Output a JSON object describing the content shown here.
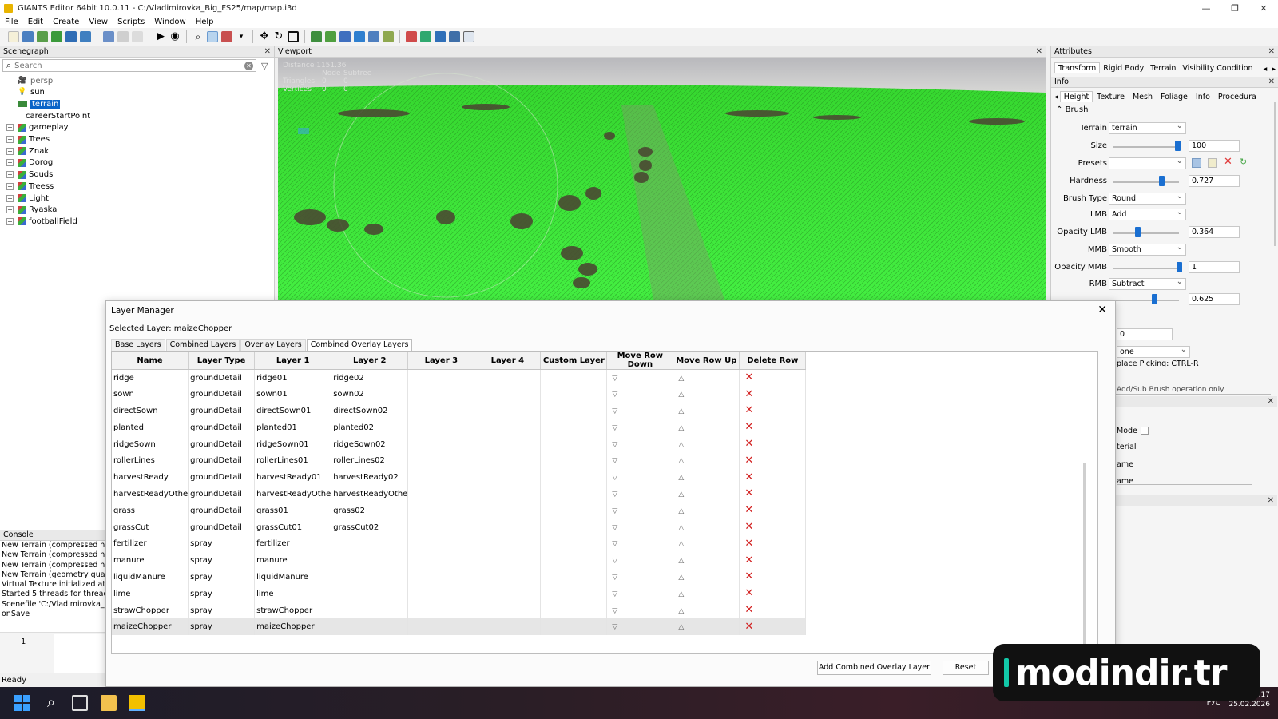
{
  "window": {
    "title": "GIANTS Editor 64bit 10.0.11 - C:/Vladimirovka_Big_FS25/map/map.i3d",
    "minimize": "—",
    "maximize": "❐",
    "close": "✕"
  },
  "menu": [
    "File",
    "Edit",
    "Create",
    "View",
    "Scripts",
    "Window",
    "Help"
  ],
  "scenegraph": {
    "header": "Scenegraph",
    "search_placeholder": "Search",
    "items": [
      {
        "label": "persp",
        "expandable": false
      },
      {
        "label": "sun",
        "expandable": false
      },
      {
        "label": "terrain",
        "expandable": false,
        "selected": true
      },
      {
        "label": "careerStartPoint",
        "expandable": false
      },
      {
        "label": "gameplay",
        "expandable": true
      },
      {
        "label": "Trees",
        "expandable": true
      },
      {
        "label": "Znaki",
        "expandable": true
      },
      {
        "label": "Dorogi",
        "expandable": true
      },
      {
        "label": "Souds",
        "expandable": true
      },
      {
        "label": "Treess",
        "expandable": true
      },
      {
        "label": "Light",
        "expandable": true
      },
      {
        "label": "Ryaska",
        "expandable": true
      },
      {
        "label": "footballField",
        "expandable": true
      }
    ]
  },
  "viewport": {
    "header": "Viewport",
    "stats": {
      "distance": "Distance 1151.36",
      "col_node": "Node",
      "col_subtree": "Subtree",
      "triangles_label": "Triangles",
      "triangles_node": "0",
      "triangles_subtree": "0",
      "vertices_label": "Vertices",
      "vertices_node": "0",
      "vertices_subtree": "0"
    }
  },
  "attributes": {
    "header": "Attributes",
    "tabs": [
      "Transform",
      "Rigid Body",
      "Terrain",
      "Visibility Condition"
    ],
    "info_header": "Info",
    "subtabs": [
      "Height",
      "Texture",
      "Mesh",
      "Foliage",
      "Info",
      "Procedura"
    ],
    "brush_section": "Brush",
    "terrain_label": "Terrain",
    "terrain_value": "terrain",
    "size_label": "Size",
    "size_value": "100",
    "size_level": 0.98,
    "presets_label": "Presets",
    "presets_value": "",
    "hardness_label": "Hardness",
    "hardness_value": "0.727",
    "hardness_level": 0.727,
    "brush_type_label": "Brush Type",
    "brush_type_value": "Round",
    "lmb_label": "LMB",
    "lmb_value": "Add",
    "opacity_lmb_label": "Opacity LMB",
    "opacity_lmb_value": "0.364",
    "opacity_lmb_level": 0.364,
    "mmb_label": "MMB",
    "mmb_value": "Smooth",
    "opacity_mmb_label": "Opacity MMB",
    "opacity_mmb_value": "1",
    "opacity_mmb_level": 1.0,
    "rmb_label": "RMB",
    "rmb_value": "Subtract",
    "opacity_rmb_value": "0.625",
    "opacity_rmb_level": 0.625,
    "partial_zero": "0",
    "partial_none": "one",
    "partial_picking": "place Picking: CTRL-R",
    "partial_addsub": "Add/Sub Brush operation only",
    "partial_mode": "Mode",
    "partial_terial": "terial",
    "partial_name": "ame",
    "partial_name2": "ame"
  },
  "console": {
    "header": "Console",
    "lines": [
      "New Terrain (compressed height",
      "New Terrain (compressed height",
      "New Terrain (compressed height",
      "New Terrain (geometry quadtree",
      "Virtual Texture initialized at 4096",
      "Started 5 threads for threadpool",
      "Scenefile 'C:/Vladimirovka_Big_FS25",
      "onSave"
    ],
    "line_number": "1"
  },
  "status": "Ready",
  "layer_manager": {
    "title": "Layer Manager",
    "close": "✕",
    "selected_layer": "Selected Layer: maizeChopper",
    "tabs": [
      "Base Layers",
      "Combined Layers",
      "Overlay Layers",
      "Combined Overlay Layers"
    ],
    "active_tab": 3,
    "columns": [
      "Name",
      "Layer Type",
      "Layer 1",
      "Layer 2",
      "Layer 3",
      "Layer 4",
      "Custom Layer",
      "Move Row Down",
      "Move Row Up",
      "Delete Row"
    ],
    "rows": [
      [
        "ridge",
        "groundDetail",
        "ridge01",
        "ridge02"
      ],
      [
        "sown",
        "groundDetail",
        "sown01",
        "sown02"
      ],
      [
        "directSown",
        "groundDetail",
        "directSown01",
        "directSown02"
      ],
      [
        "planted",
        "groundDetail",
        "planted01",
        "planted02"
      ],
      [
        "ridgeSown",
        "groundDetail",
        "ridgeSown01",
        "ridgeSown02"
      ],
      [
        "rollerLines",
        "groundDetail",
        "rollerLines01",
        "rollerLines02"
      ],
      [
        "harvestReady",
        "groundDetail",
        "harvestReady01",
        "harvestReady02"
      ],
      [
        "harvestReadyOthe",
        "groundDetail",
        "harvestReadyOthe",
        "harvestReadyOthe"
      ],
      [
        "grass",
        "groundDetail",
        "grass01",
        "grass02"
      ],
      [
        "grassCut",
        "groundDetail",
        "grassCut01",
        "grassCut02"
      ],
      [
        "fertilizer",
        "spray",
        "fertilizer",
        ""
      ],
      [
        "manure",
        "spray",
        "manure",
        ""
      ],
      [
        "liquidManure",
        "spray",
        "liquidManure",
        ""
      ],
      [
        "lime",
        "spray",
        "lime",
        ""
      ],
      [
        "strawChopper",
        "spray",
        "strawChopper",
        ""
      ],
      [
        "maizeChopper",
        "spray",
        "maizeChopper",
        ""
      ]
    ],
    "selected_row": 15,
    "icons": {
      "down": "▽",
      "up": "△",
      "delete": "✕"
    },
    "add_button": "Add Combined Overlay Layer",
    "reset_button": "Reset"
  },
  "taskbar": {
    "lang": "РУС",
    "time": "0:17",
    "date": "25.02.2026"
  },
  "watermark": "modindir.tr",
  "colors": {
    "selection": "#0a64c8",
    "terrain_green": "#3fe63c",
    "delete_red": "#d21f1f",
    "slider_thumb": "#1a6fd1"
  }
}
